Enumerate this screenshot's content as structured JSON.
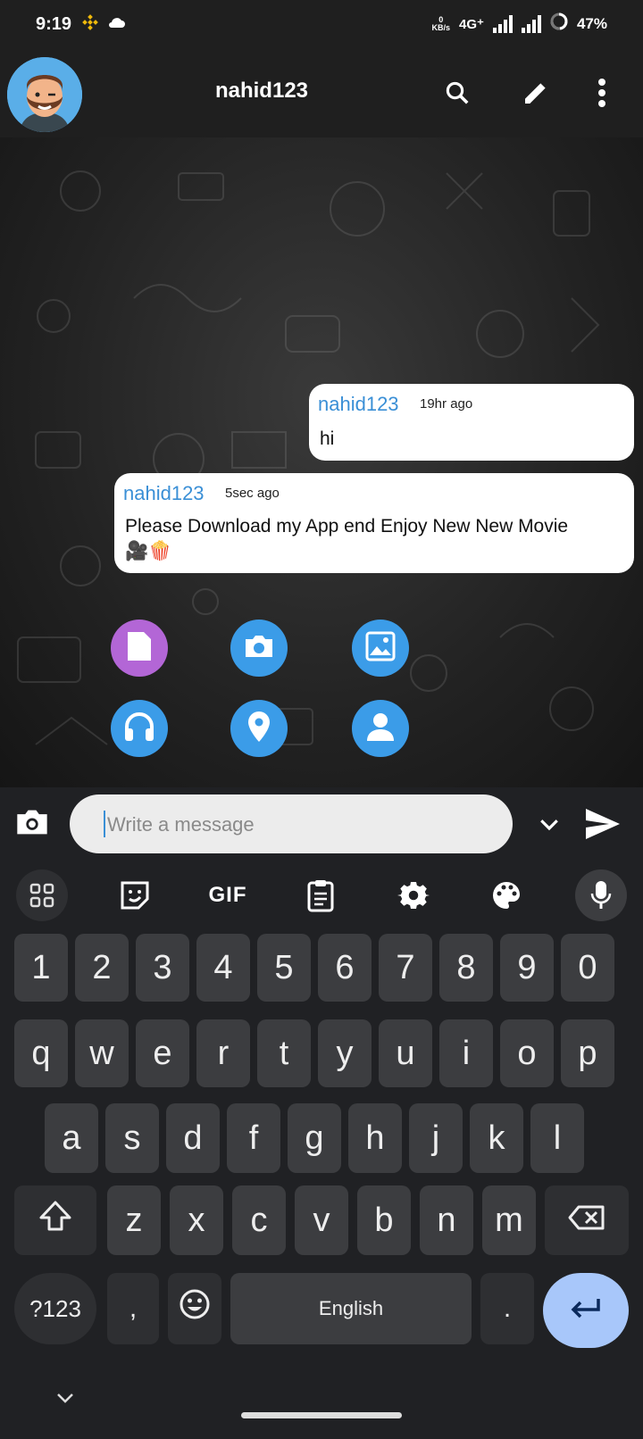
{
  "status_bar": {
    "time": "9:19",
    "net_speed_value": "0",
    "net_speed_unit": "KB/s",
    "network": "4G⁺",
    "battery": "47%"
  },
  "app_bar": {
    "title": "nahid123",
    "icons": [
      "search-icon",
      "edit-icon",
      "more-vert-icon"
    ]
  },
  "messages": [
    {
      "sender": "nahid123",
      "time": "19hr ago",
      "text": "hi",
      "emoji": ""
    },
    {
      "sender": "nahid123",
      "time": "5sec ago",
      "text": "Please Download my App end Enjoy New New Movie",
      "emoji": "🎥🍿"
    }
  ],
  "attach_options": [
    {
      "icon": "file-icon",
      "color": "#b366d6"
    },
    {
      "icon": "camera-icon",
      "color": "#3b9ce8"
    },
    {
      "icon": "image-icon",
      "color": "#3b9ce8"
    },
    {
      "icon": "headphones-icon",
      "color": "#3b9ce8"
    },
    {
      "icon": "location-icon",
      "color": "#3b9ce8"
    },
    {
      "icon": "contact-icon",
      "color": "#3b9ce8"
    }
  ],
  "input": {
    "placeholder": "Write a message",
    "value": ""
  },
  "keyboard": {
    "toolbar": [
      "apps-icon",
      "sticker-icon",
      "GIF",
      "clipboard-icon",
      "settings-icon",
      "palette-icon",
      "mic-icon"
    ],
    "gif_label": "GIF",
    "row_numbers": [
      "1",
      "2",
      "3",
      "4",
      "5",
      "6",
      "7",
      "8",
      "9",
      "0"
    ],
    "row1": [
      "q",
      "w",
      "e",
      "r",
      "t",
      "y",
      "u",
      "i",
      "o",
      "p"
    ],
    "row2": [
      "a",
      "s",
      "d",
      "f",
      "g",
      "h",
      "j",
      "k",
      "l"
    ],
    "row3": [
      "z",
      "x",
      "c",
      "v",
      "b",
      "n",
      "m"
    ],
    "symbols_label": "?123",
    "comma": ",",
    "space_label": "English",
    "period": "."
  },
  "colors": {
    "accent": "#3a8fd6",
    "enter_key": "#a8c7fa",
    "key_bg": "#3c3d40"
  }
}
